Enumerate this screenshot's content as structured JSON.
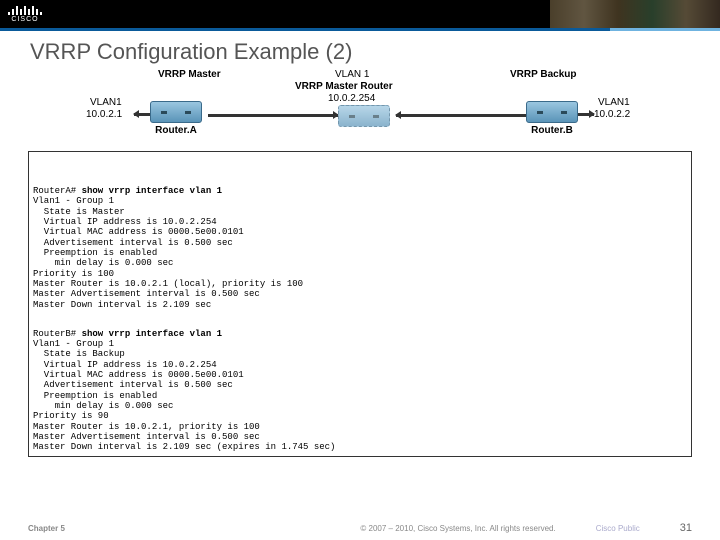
{
  "brand": {
    "name": "CISCO"
  },
  "title": "VRRP Configuration Example (2)",
  "diagram": {
    "vlan_top": "VLAN 1",
    "master_role": "VRRP Master Router",
    "master_ip": "10.0.2.254",
    "left_role": "VRRP Master",
    "left_vlan": "VLAN1",
    "left_ip": "10.0.2.1",
    "left_name": "Router.A",
    "right_role": "VRRP Backup",
    "right_vlan": "VLAN1",
    "right_ip": "10.0.2.2",
    "right_name": "Router.B"
  },
  "output_a": {
    "prompt": "RouterA# ",
    "cmd": "show vrrp interface vlan 1",
    "lines": "Vlan1 - Group 1\n  State is Master\n  Virtual IP address is 10.0.2.254\n  Virtual MAC address is 0000.5e00.0101\n  Advertisement interval is 0.500 sec\n  Preemption is enabled\n    min delay is 0.000 sec\nPriority is 100\nMaster Router is 10.0.2.1 (local), priority is 100\nMaster Advertisement interval is 0.500 sec\nMaster Down interval is 2.109 sec"
  },
  "output_b": {
    "prompt": "RouterB# ",
    "cmd": "show vrrp interface vlan 1",
    "lines": "Vlan1 - Group 1\n  State is Backup\n  Virtual IP address is 10.0.2.254\n  Virtual MAC address is 0000.5e00.0101\n  Advertisement interval is 0.500 sec\n  Preemption is enabled\n    min delay is 0.000 sec\nPriority is 90\nMaster Router is 10.0.2.1, priority is 100\nMaster Advertisement interval is 0.500 sec\nMaster Down interval is 2.109 sec (expires in 1.745 sec)"
  },
  "footer": {
    "chapter": "Chapter 5",
    "copyright": "© 2007 – 2010, Cisco Systems, Inc. All rights reserved.",
    "public": "Cisco Public",
    "page": "31"
  }
}
